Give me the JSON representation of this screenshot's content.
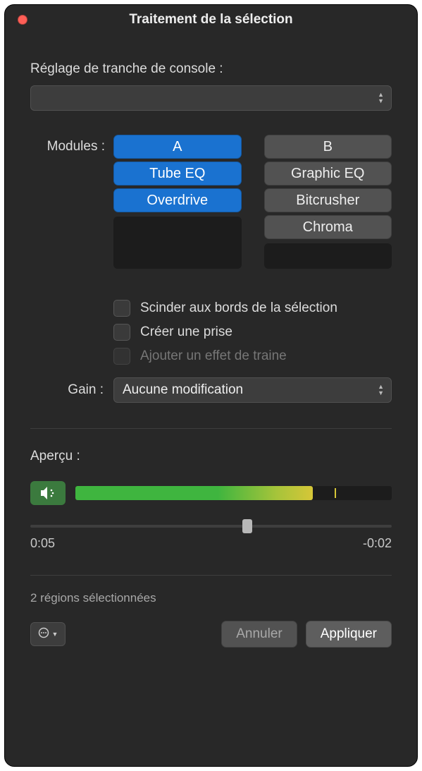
{
  "window": {
    "title": "Traitement de la sélection"
  },
  "channel_strip": {
    "label": "Réglage de tranche de console :",
    "value": ""
  },
  "modules": {
    "label": "Modules :",
    "colA": {
      "header": "A",
      "items": [
        "Tube EQ",
        "Overdrive"
      ]
    },
    "colB": {
      "header": "B",
      "items": [
        "Graphic EQ",
        "Bitcrusher",
        "Chroma"
      ]
    }
  },
  "options": {
    "split": "Scinder aux bords de la sélection",
    "take": "Créer une prise",
    "tail": "Ajouter un effet de traine"
  },
  "gain": {
    "label": "Gain :",
    "value": "Aucune modification"
  },
  "preview": {
    "label": "Aperçu :",
    "time_start": "0:05",
    "time_end": "-0:02"
  },
  "status": "2 régions sélectionnées",
  "buttons": {
    "cancel": "Annuler",
    "apply": "Appliquer"
  }
}
